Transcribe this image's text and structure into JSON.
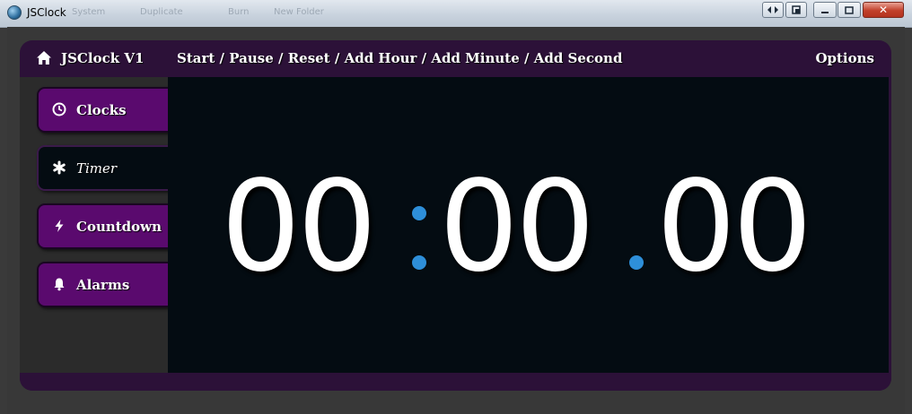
{
  "window": {
    "title": "JSClock",
    "ghost_menu": [
      "System",
      "Duplicate",
      "Burn",
      "New Folder"
    ],
    "close_glyph": "✕"
  },
  "topbar": {
    "brand": "JSClock V1",
    "actions": [
      "Start",
      "Pause",
      "Reset",
      "Add Hour",
      "Add Minute",
      "Add Second"
    ],
    "options_label": "Options"
  },
  "nav": [
    {
      "label": "Clocks",
      "icon": "clock-icon",
      "active": false
    },
    {
      "label": "Timer",
      "icon": "asterisk-icon",
      "active": true
    },
    {
      "label": "Countdown",
      "icon": "bolt-icon",
      "active": false
    },
    {
      "label": "Alarms",
      "icon": "bell-icon",
      "active": false
    }
  ],
  "timer": {
    "hours": "00",
    "minutes": "00",
    "hundredths": "00"
  },
  "colors": {
    "accent": "#2e8fd9",
    "nav": "#5a0a6e",
    "bar": "#2c1138",
    "display": "#040c12"
  }
}
